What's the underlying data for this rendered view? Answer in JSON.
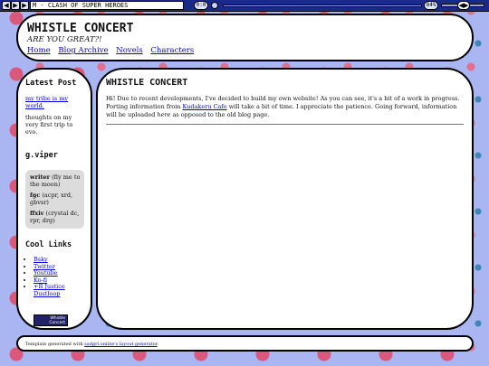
{
  "player": {
    "prev_icon": "◀",
    "play_icon": "▶",
    "next_icon": "▶",
    "track_title": "M - CLASH OF SUPER HEROES",
    "time": "0:0",
    "volume": "84%",
    "volume_handle": "◀▶"
  },
  "header": {
    "title": "WHISTLE CONCERT",
    "tagline": "ARE YOU GREAT?!",
    "nav": [
      "Home",
      "Blog Archive",
      "Novels",
      "Characters"
    ]
  },
  "sidebar": {
    "latest_post_heading": "Latest Post",
    "latest_post_link": "my tribe is my world.",
    "latest_post_desc": "thoughts on my very first trip to evo.",
    "gviper_heading": "g.viper",
    "gviper_items": [
      {
        "key": "writer",
        "value": "(fly me to the moon)"
      },
      {
        "key": "fgc",
        "value": "(acpr, xrd, gbvsr)"
      },
      {
        "key": "ffxiv",
        "value": "(crystal dc, rpr, drg)"
      }
    ],
    "cool_links_heading": "Cool Links",
    "cool_links": [
      "Bsky",
      "Twitter",
      "Youtube",
      "Ko-fi",
      "+R Justice Dustloop"
    ],
    "badge_text": "Whistle Concert"
  },
  "main": {
    "title": "WHISTLE CONCERT",
    "text_part1": "Hi! Due to recent developments, I've decided to build my own website! As you can see, it's a bit of a work in progress. Porting information from ",
    "text_link": "Kudakeru Cafe",
    "text_part2": " will take a bit of time. I appreciate the patience. Going forward, information will be uploaded ",
    "text_emph": "here",
    "text_part3": " as opposed to the old blog page."
  },
  "footer": {
    "prefix": "Template generated with ",
    "link": "sadgrl.online's layout generator",
    "suffix": "."
  },
  "colors": {
    "background": "#a9b6f2",
    "player_bar": "#1a2a8a",
    "link": "#0000ee",
    "card": "#dcdcdc"
  }
}
